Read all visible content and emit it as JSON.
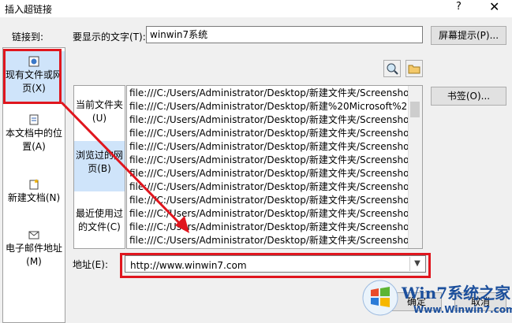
{
  "dialog": {
    "title": "插入超链接",
    "help": "?",
    "close": "✕"
  },
  "link_to": {
    "label": "链接到:",
    "items": [
      {
        "label": "现有文件或网页(X)",
        "icon": "web-page-icon",
        "selected": true
      },
      {
        "label": "本文档中的位置(A)",
        "icon": "document-place-icon",
        "selected": false
      },
      {
        "label": "新建文档(N)",
        "icon": "new-document-icon",
        "selected": false
      },
      {
        "label": "电子邮件地址(M)",
        "icon": "email-icon",
        "selected": false
      }
    ]
  },
  "display_text": {
    "label": "要显示的文字(T):",
    "value": "winwin7系统"
  },
  "screen_tip_button": "屏幕提示(P)...",
  "bookmark_button": "书签(O)...",
  "subtabs": [
    {
      "label": "当前文件夹(U)",
      "selected": false
    },
    {
      "label": "浏览过的网页(B)",
      "selected": true
    },
    {
      "label": "最近使用过的文件(C)",
      "selected": false
    }
  ],
  "browsed_pages": [
    "file:///C:/Users/Administrator/Desktop/新建文件夹/Screenshot",
    "file:///C:/Users/Administrator/Desktop/新建%20Microsoft%20",
    "file:///C:/Users/Administrator/Desktop/新建文件夹/Screenshot",
    "file:///C:/Users/Administrator/Desktop/新建文件夹/Screenshot",
    "file:///C:/Users/Administrator/Desktop/新建文件夹/Screenshot",
    "file:///C:/Users/Administrator/Desktop/新建文件夹/Screenshot",
    "file:///C:/Users/Administrator/Desktop/新建文件夹/Screenshot",
    "file:///C:/Users/Administrator/Desktop/新建文件夹/Screenshot",
    "file:///C:/Users/Administrator/Desktop/新建文件夹/Screenshot",
    "file:///C:/Users/Administrator/Desktop/新建文件夹/Screenshot",
    "file:///C:/Users/Administrator/Desktop/新建文件夹/Screenshot",
    "file:///C:/Users/Administrator/Desktop/新建文件夹/Screenshot"
  ],
  "address": {
    "label": "地址(E):",
    "value": "http://www.winwin7.com"
  },
  "ok_button": "确定",
  "cancel_button": "取消",
  "watermark": {
    "text": "Win7系统之家",
    "url": "Www.Winwin7.com"
  },
  "colors": {
    "highlight": "#e0161e",
    "selected": "#cfe4fa"
  }
}
